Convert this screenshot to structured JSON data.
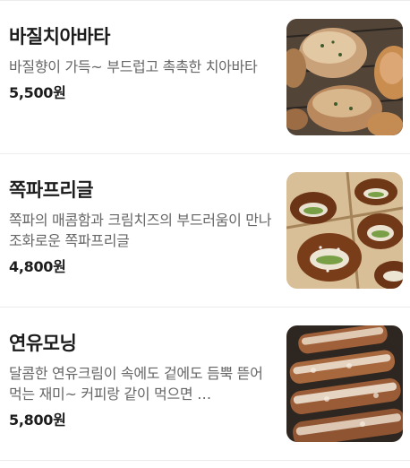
{
  "menu": {
    "items": [
      {
        "name": "바질치아바타",
        "description": "바질향이 가득~ 부드럽고 촉촉한 치아바타",
        "price": "5,500원",
        "image": "ciabatta-photo"
      },
      {
        "name": "쪽파프리글",
        "description": "쪽파의 매콤함과 크림치즈의 부드러움이 만나 조화로운 쪽파프리글",
        "price": "4,800원",
        "image": "pretzel-photo"
      },
      {
        "name": "연유모닝",
        "description": "달콤한 연유크림이 속에도 겉에도 듬뿍 뜯어먹는 재미~ 커피랑 같이 먹으면 …",
        "price": "5,800원",
        "image": "morning-bread-photo"
      }
    ]
  }
}
